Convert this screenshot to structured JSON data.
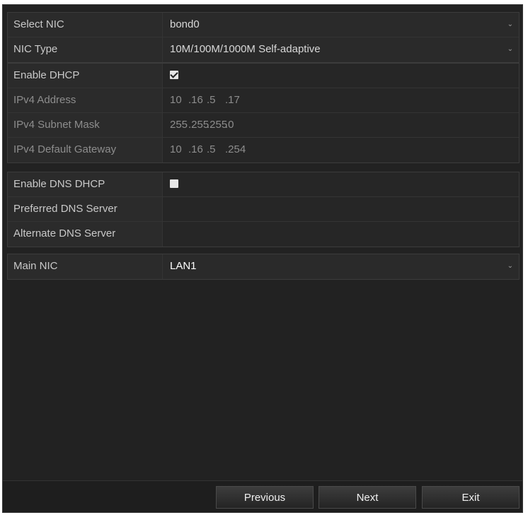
{
  "wizard": {
    "select_nic": {
      "label": "Select NIC",
      "value": "bond0"
    },
    "nic_type": {
      "label": "NIC Type",
      "value": "10M/100M/1000M Self-adaptive"
    },
    "enable_dhcp": {
      "label": "Enable DHCP",
      "checked": true
    },
    "ipv4_address": {
      "label": "IPv4 Address",
      "octets": [
        "10",
        ".16",
        ".5",
        ".17"
      ]
    },
    "ipv4_subnet_mask": {
      "label": "IPv4 Subnet Mask",
      "octets": [
        "255",
        ".255",
        ".255",
        ".0"
      ]
    },
    "ipv4_default_gateway": {
      "label": "IPv4 Default Gateway",
      "octets": [
        "10",
        ".16",
        ".5",
        ".254"
      ]
    },
    "enable_dns_dhcp": {
      "label": "Enable DNS DHCP",
      "checked": false
    },
    "preferred_dns": {
      "label": "Preferred DNS Server",
      "value": ""
    },
    "alternate_dns": {
      "label": "Alternate DNS Server",
      "value": ""
    },
    "main_nic": {
      "label": "Main NIC",
      "value": "LAN1"
    }
  },
  "buttons": {
    "previous": "Previous",
    "next": "Next",
    "exit": "Exit"
  },
  "icons": {
    "dropdown": "chevron-down-icon",
    "checkbox": "checkbox-icon"
  },
  "colors": {
    "background": "#222222",
    "label_bg": "#2b2b2b",
    "value_bg": "#262626"
  }
}
